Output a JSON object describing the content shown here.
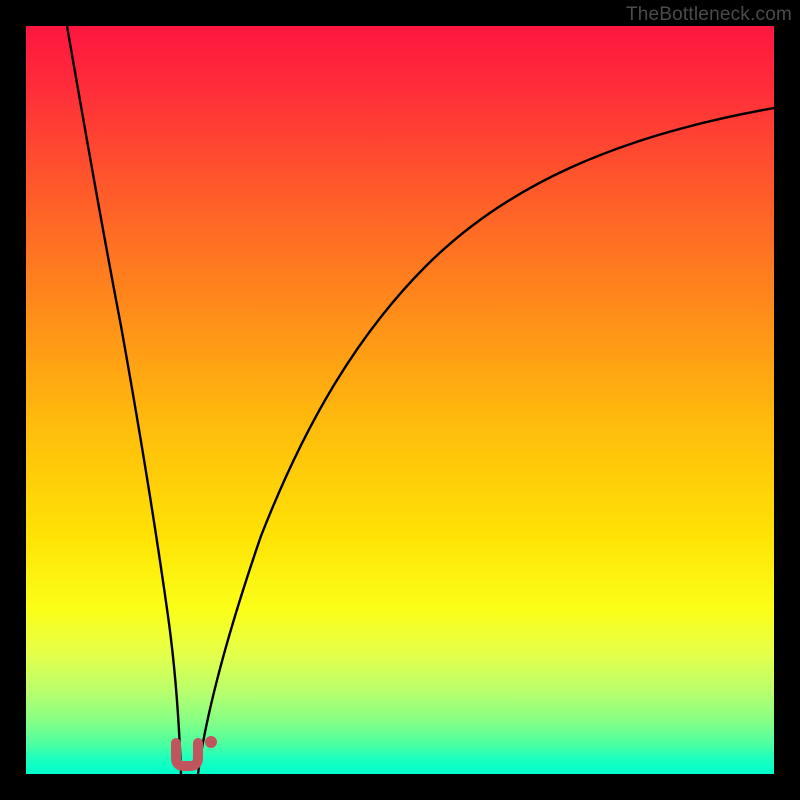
{
  "watermark": "TheBottleneck.com",
  "chart_data": {
    "type": "line",
    "title": "",
    "xlabel": "",
    "ylabel": "",
    "xlim": [
      0,
      100
    ],
    "ylim": [
      0,
      100
    ],
    "gradient_stops": [
      {
        "pos": 0,
        "color": "#ff163f"
      },
      {
        "pos": 8,
        "color": "#ff2c3a"
      },
      {
        "pos": 22,
        "color": "#ff5a2a"
      },
      {
        "pos": 38,
        "color": "#ff8c1a"
      },
      {
        "pos": 52,
        "color": "#ffb80d"
      },
      {
        "pos": 68,
        "color": "#ffe205"
      },
      {
        "pos": 78,
        "color": "#fbff18"
      },
      {
        "pos": 84,
        "color": "#e4ff4a"
      },
      {
        "pos": 89,
        "color": "#b8ff6d"
      },
      {
        "pos": 93,
        "color": "#84ff85"
      },
      {
        "pos": 96,
        "color": "#4cffa0"
      },
      {
        "pos": 98,
        "color": "#1affbf"
      },
      {
        "pos": 100,
        "color": "#00ffcc"
      }
    ],
    "series": [
      {
        "name": "left-curve",
        "x": [
          5.5,
          8,
          10,
          12,
          14,
          16,
          18,
          19,
          20,
          20.7
        ],
        "y": [
          100,
          85,
          72,
          58,
          44,
          30,
          16,
          9,
          3,
          0
        ]
      },
      {
        "name": "right-curve",
        "x": [
          23,
          24,
          26,
          29,
          33,
          38,
          44,
          51,
          60,
          70,
          82,
          100
        ],
        "y": [
          0,
          5,
          14,
          26,
          38,
          49,
          58,
          66,
          73,
          79,
          84,
          89
        ]
      }
    ],
    "markers": [
      {
        "name": "u-marker",
        "cx": 21.0,
        "cy": 2.2,
        "shape": "u",
        "color": "#c0555e"
      },
      {
        "name": "dot-marker",
        "cx": 24.5,
        "cy": 4.3,
        "shape": "circle",
        "color": "#c0555e"
      }
    ]
  }
}
